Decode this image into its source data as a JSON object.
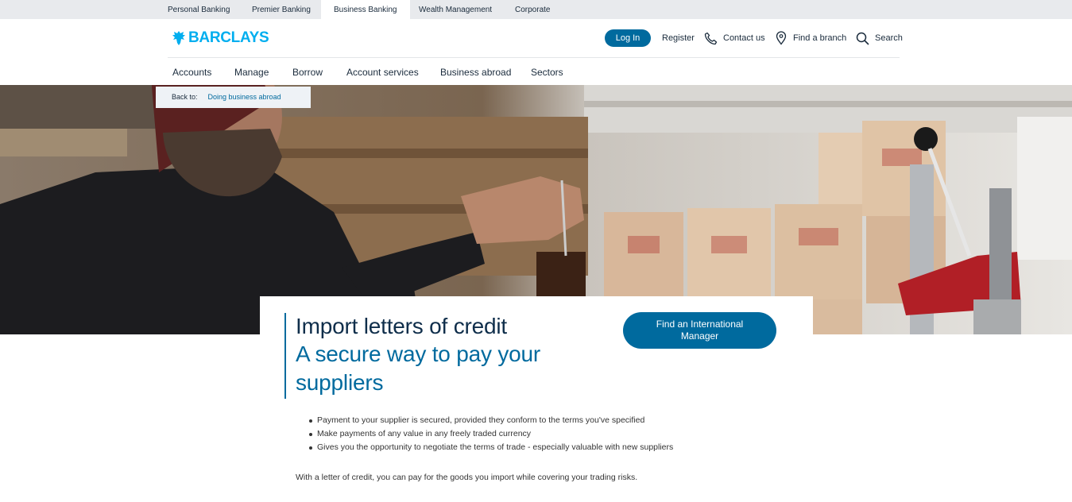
{
  "segments": [
    {
      "label": "Personal Banking",
      "active": false
    },
    {
      "label": "Premier Banking",
      "active": false
    },
    {
      "label": "Business Banking",
      "active": true
    },
    {
      "label": "Wealth Management",
      "active": false
    },
    {
      "label": "Corporate",
      "active": false
    }
  ],
  "header": {
    "logo_text": "BARCLAYS",
    "login_label": "Log In",
    "register_label": "Register",
    "contact_label": "Contact us",
    "branch_label": "Find a branch",
    "search_label": "Search"
  },
  "nav": [
    "Accounts",
    "Manage",
    "Borrow",
    "Account services",
    "Business abroad",
    "Sectors"
  ],
  "breadcrumb": {
    "prefix": "Back to:",
    "link": "Doing business abroad"
  },
  "hero": {
    "title": "Import letters of credit",
    "subtitle": "A secure way to pay your suppliers",
    "cta_label": "Find an International Manager"
  },
  "bullets": [
    "Payment to your supplier is secured, provided they conform to the terms you've specified",
    "Make payments of any value in any freely traded currency",
    "Gives you the opportunity to negotiate the terms of trade - especially valuable with new suppliers"
  ],
  "intro": "With a letter of credit, you can pay for the goods you import while covering your trading risks.",
  "colors": {
    "brand": "#00aeef",
    "primary": "#006a9e",
    "navy": "#0f2e4b"
  }
}
